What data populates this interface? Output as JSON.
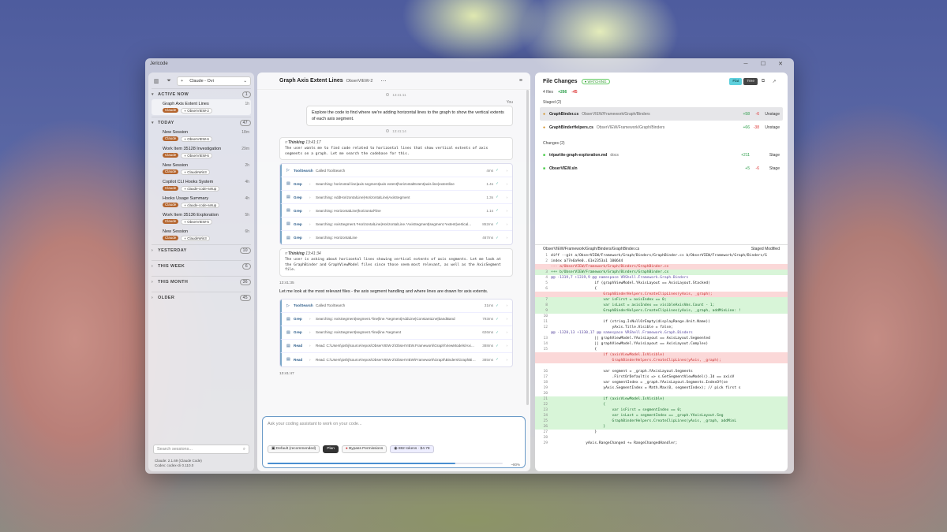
{
  "app": {
    "title": "Jericode"
  },
  "sidebar": {
    "model": "Claude - Ovi",
    "groups": {
      "active": {
        "label": "ACTIVE NOW",
        "count": "1"
      },
      "today": {
        "label": "TODAY",
        "count": "47"
      },
      "yesterday": {
        "label": "YESTERDAY",
        "count": "10"
      },
      "week": {
        "label": "THIS WEEK",
        "count": "6"
      },
      "month": {
        "label": "THIS MONTH",
        "count": "36"
      },
      "older": {
        "label": "OLDER",
        "count": "45"
      }
    },
    "active_sessions": [
      {
        "name": "Graph Axis Extent Lines",
        "time": "1h",
        "tag": "Claude",
        "branch": "ObserVIEW-2"
      }
    ],
    "today_sessions": [
      {
        "name": "New Session",
        "time": "18m",
        "tag": "Claude",
        "branch": "ObserVIEW-6"
      },
      {
        "name": "Work Item 35128 Investigation",
        "time": "29m",
        "tag": "Claude",
        "branch": "ObserVIEW-6"
      },
      {
        "name": "New Session",
        "time": "2h",
        "tag": "Claude",
        "branch": "ClaudeWin3"
      },
      {
        "name": "Copilot CLI Hooks System",
        "time": "4h",
        "tag": "Claude",
        "branch": "claude-code-setup"
      },
      {
        "name": "Hooks Usage Summary",
        "time": "4h",
        "tag": "Claude",
        "branch": "claude-code-setup"
      },
      {
        "name": "Work Item 35136 Exploration",
        "time": "5h",
        "tag": "Claude",
        "branch": "ObserVIEW-5"
      },
      {
        "name": "New Session",
        "time": "6h",
        "tag": "Claude",
        "branch": "ClaudeWin3"
      }
    ],
    "search_placeholder": "Search sessions...",
    "footer1": "Claude: 2.1.69 (Claude Code)",
    "footer2": "Codex: codex-cli 0.110.0"
  },
  "chat": {
    "title": "Graph Axis Extent Lines",
    "subtitle": "ObserVIEW-2",
    "ts1": "13:41:11",
    "you": "You",
    "user_msg": "Explore the code to find where we're adding horizontal lines to the graph to show the vertical extents of each axis segment.",
    "ts2": "13:41:14",
    "think1": {
      "label": "Thinking",
      "time": "13:41:17",
      "text": "The user wants me to find code related to horizontal lines that show vertical extents of axis segments on a graph. Let me search the codebase for this."
    },
    "tools1": [
      {
        "icon": "▷",
        "name": "ToolSearch",
        "desc": "Called ToolSearch",
        "dur": "4ms"
      },
      {
        "icon": "▤",
        "name": "Grep",
        "desc": "Searching: horizontal line|axis segment|axis extent|horizontalExtent|axis.line|extentline",
        "dur": "1.4s"
      },
      {
        "icon": "▤",
        "name": "Grep",
        "desc": "Searching: AddHorizontalLine|HorizontalLine|AxisSegment",
        "dur": "1.3s"
      },
      {
        "icon": "▤",
        "name": "Grep",
        "desc": "Searching: HorizontalLine|horizontal*line",
        "dur": "1.1s"
      },
      {
        "icon": "▤",
        "name": "Grep",
        "desc": "Searching: AxisSegment.*HorizontalLine|HorizontalLine.*AxisSegment|segment.*extent|vertical...",
        "dur": "852ms"
      },
      {
        "icon": "▤",
        "name": "Grep",
        "desc": "Searching: HorizontalLine",
        "dur": "467ms"
      }
    ],
    "think2": {
      "label": "Thinking",
      "time": "13:41:34",
      "text": "The user is asking about horizontal lines showing vertical extents of axis segments. Let me look at the GraphBinder and GraphViewModel files since those seem most relevant, as well as the AxisSegment file."
    },
    "ts3": "13:41:35",
    "assistant_text": "Let me look at the most relevant files - the axis segment handling and where lines are drawn for axis extents.",
    "tools2": [
      {
        "icon": "▷",
        "name": "ToolSearch",
        "desc": "Called ToolSearch",
        "dur": "31ms"
      },
      {
        "icon": "▤",
        "name": "Grep",
        "desc": "Searching: AxisSegment|segment.*line|line.*segment|AddLine|ConstantLine|bandBand",
        "dur": "793ms"
      },
      {
        "icon": "▤",
        "name": "Grep",
        "desc": "Searching: AxisSegment|segment.*line|line.*segment",
        "dur": "626ms"
      },
      {
        "icon": "▤",
        "name": "Read",
        "desc": "Read: C:\\Users\\joshj\\source\\repos\\ObserVIEW-2\\ObserVIEW.Framework\\Graph\\ViewModels\\AxisSeg...",
        "dur": "388ms"
      },
      {
        "icon": "▤",
        "name": "Read",
        "desc": "Read: C:\\Users\\joshj\\source\\repos\\ObserVIEW-2\\ObserVIEW\\Framework\\Graph\\Binders\\GraphBind...",
        "dur": "385ms"
      }
    ],
    "ts4": "13:41:47",
    "composer": {
      "placeholder": "Ask your coding assistant to work on your code...",
      "mode": "Default (recommended)",
      "plan": "Plan",
      "perm": "Bypass Permissions",
      "tokens": "882 tokens · $4.78",
      "progress": 0.8,
      "pct": "~80%"
    }
  },
  "files": {
    "title": "File Changes",
    "watch": "WATCHING",
    "flat": "Flat",
    "tree": "Tree",
    "count": "4 files",
    "adds": "+266",
    "dels": "-45",
    "staged_label": "Staged (2)",
    "staged": [
      {
        "name": "GraphBinder.cs",
        "path": "ObserVIEW/Framework/Graph/Binders",
        "add": "+58",
        "del": "-6",
        "action": "Unstage"
      },
      {
        "name": "GraphBinderHelpers.cs",
        "path": "ObserVIEW/Framework/Graph/Binders",
        "add": "+66",
        "del": "-38",
        "action": "Unstage"
      }
    ],
    "changes_label": "Changes (2)",
    "changes": [
      {
        "name": "tripartite-graph-exploration.md",
        "path": "docs",
        "add": "+211",
        "del": "",
        "action": "Stage"
      },
      {
        "name": "ObserVIEW.sln",
        "path": "",
        "add": "+5",
        "del": "-6",
        "action": "Stage"
      }
    ],
    "diff_path": "ObserVIEW/Framework/Graph/Binders/GraphBinder.cs",
    "diff_status": "Staged  Modified",
    "diff": [
      {
        "t": "",
        "n": "1",
        "c": "diff --git a/ObserVIEW/Framework/Graph/Binders/GraphBinder.cs b/ObserVIEW/Framework/Graph/Binders/G"
      },
      {
        "t": "",
        "n": "2",
        "c": "index a77e6a9e0..61e2353a1 100644"
      },
      {
        "t": "del",
        "n": "",
        "c": "--- a/ObserVIEW/Framework/Graph/Binders/GraphBinder.cs"
      },
      {
        "t": "add",
        "n": "3",
        "c": "+++ b/ObserVIEW/Framework/Graph/Binders/GraphBinder.cs"
      },
      {
        "t": "hunk",
        "n": "4",
        "c": "@@ -1319,7 +1319,9 @@ namespace VRShell.Framework.Graph.Binders"
      },
      {
        "t": "",
        "n": "5",
        "c": "                    if (graphViewModel.YAxisLayout == AxisLayout.Stacked)"
      },
      {
        "t": "",
        "n": "6",
        "c": "                    {"
      },
      {
        "t": "del",
        "n": "",
        "c": "                        GraphBinderHelpers.CreateClipLines(yAxis, _graph);"
      },
      {
        "t": "add",
        "n": "7",
        "c": "                        var isFirst = axisIndex == 0;"
      },
      {
        "t": "add",
        "n": "8",
        "c": "                        var isLast = axisIndex == visibleAxisVms.Count - 1;"
      },
      {
        "t": "add",
        "n": "9",
        "c": "                        GraphBinderHelpers.CreateClipLines(yAxis, _graph, addMinLine: !"
      },
      {
        "t": "",
        "n": "10",
        "c": ""
      },
      {
        "t": "",
        "n": "11",
        "c": "                        if (string.IsNullOrEmpty(displayRange.Unit.Name))"
      },
      {
        "t": "",
        "n": "12",
        "c": "                            yAxis.Title.Visible = false;"
      },
      {
        "t": "hunk",
        "n": "",
        "c": "@@ -1328,13 +1330,17 @@ namespace VRShell.Framework.Graph.Binders"
      },
      {
        "t": "",
        "n": "13",
        "c": "                    || graphViewModel.YAxisLayout == AxisLayout.Segmented"
      },
      {
        "t": "",
        "n": "14",
        "c": "                    || graphViewModel.YAxisLayout == AxisLayout.Complex)"
      },
      {
        "t": "",
        "n": "15",
        "c": "                    {"
      },
      {
        "t": "del",
        "n": "",
        "c": "                        if (axisViewModel.IsVisible)"
      },
      {
        "t": "del",
        "n": "",
        "c": "                            GraphBinderHelpers.CreateClipLines(yAxis, _graph);"
      },
      {
        "t": "",
        "n": "",
        "c": ""
      },
      {
        "t": "",
        "n": "16",
        "c": "                        var segment = _graph.YAxisLayout.Segments"
      },
      {
        "t": "",
        "n": "17",
        "c": "                            .FirstOrDefault(s => s.GetSegmentViewModel().Id == axisV"
      },
      {
        "t": "",
        "n": "18",
        "c": "                        var segmentIndex = _graph.YAxisLayout.Segments.IndexOf(se"
      },
      {
        "t": "",
        "n": "19",
        "c": "                        yAxis.SegmentIndex = Math.Max(0, segmentIndex); // pick first s"
      },
      {
        "t": "",
        "n": "20",
        "c": ""
      },
      {
        "t": "add",
        "n": "21",
        "c": "                        if (axisViewModel.IsVisible)"
      },
      {
        "t": "add",
        "n": "22",
        "c": "                        {"
      },
      {
        "t": "add",
        "n": "23",
        "c": "                            var isFirst = segmentIndex == 0;"
      },
      {
        "t": "add",
        "n": "24",
        "c": "                            var isLast = segmentIndex == _graph.YAxisLayout.Seg"
      },
      {
        "t": "add",
        "n": "25",
        "c": "                            GraphBinderHelpers.CreateClipLines(yAxis, _graph, addMinL"
      },
      {
        "t": "add",
        "n": "26",
        "c": "                        }"
      },
      {
        "t": "",
        "n": "27",
        "c": "                    }"
      },
      {
        "t": "",
        "n": "28",
        "c": ""
      },
      {
        "t": "",
        "n": "29",
        "c": "                yAxis.RangeChanged += RangeChangedHandler;"
      }
    ]
  },
  "colors": {
    "accent": "#5fd0dd",
    "claude_badge": "#b4652e",
    "add": "#d8f5d8",
    "del": "#fbd8d8"
  }
}
